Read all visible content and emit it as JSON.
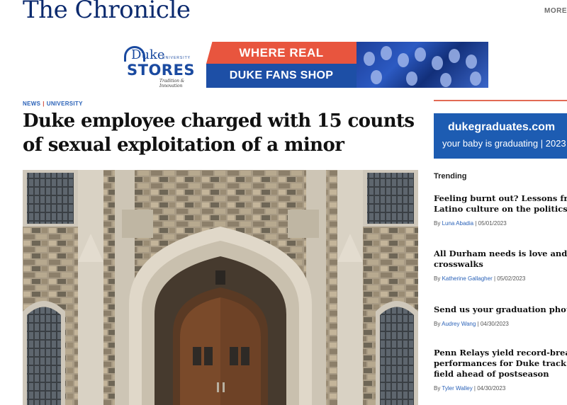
{
  "header": {
    "masthead": "The Chronicle",
    "more_label": "MORE"
  },
  "ad_banner": {
    "logo_word": "Duke",
    "logo_small": "UNIVERSITY",
    "logo_stores": "STORES",
    "logo_tagline": "Tradition & Innovation",
    "line1": "WHERE REAL",
    "line2": "DUKE FANS SHOP"
  },
  "article": {
    "kicker_news": "NEWS",
    "kicker_separator": "|",
    "kicker_section": "UNIVERSITY",
    "headline_line1": "Duke employee charged with 15 counts",
    "headline_line2": "of sexual exploitation of a minor"
  },
  "sidebar": {
    "ad_line1": "dukegraduates.com",
    "ad_line2": "your baby is graduating | 2023",
    "trending_label": "Trending",
    "items": [
      {
        "title1": "Feeling burnt out? Lessons from",
        "title2": "Latino culture on the politics of",
        "by": "By",
        "author": "Luna Abadia",
        "sep": "|",
        "date": "05/01/2023"
      },
      {
        "title1": "All Durham needs is love and",
        "title2": "crosswalks",
        "by": "By",
        "author": "Katherine Gallagher",
        "sep": "|",
        "date": "05/02/2023"
      },
      {
        "title1": "Send us your graduation photos",
        "title2": "",
        "by": "By",
        "author": "Audrey Wang",
        "sep": "|",
        "date": "04/30/2023"
      },
      {
        "title1": "Penn Relays yield record-breaking",
        "title2": "performances for Duke track and",
        "title3": "field ahead of postseason",
        "by": "By",
        "author": "Tyler Walley",
        "sep": "|",
        "date": "04/30/2023"
      }
    ]
  },
  "colors": {
    "masthead": "#0b2a6e",
    "link_blue": "#2a62b8",
    "accent_red": "#e26a54",
    "ad_blue": "#1d4fa6",
    "ad_orange": "#e8553e"
  }
}
